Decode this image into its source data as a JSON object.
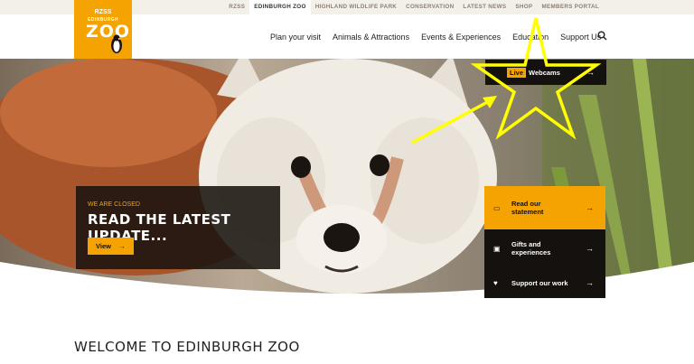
{
  "topnav": [
    "RZSS",
    "EDINBURGH ZOO",
    "HIGHLAND WILDLIFE PARK",
    "CONSERVATION",
    "LATEST NEWS",
    "SHOP",
    "MEMBERS PORTAL"
  ],
  "logo": {
    "rzss": "RZSS",
    "sub": "EDINBURGH",
    "zoo": "ZOO"
  },
  "mainnav": [
    "Plan your visit",
    "Animals & Attractions",
    "Events & Experiences",
    "Education",
    "Support Us"
  ],
  "live": {
    "badge": "Live",
    "label": "Webcams"
  },
  "closed": {
    "kicker": "WE ARE CLOSED",
    "heading": "READ THE LATEST UPDATE...",
    "button": "View"
  },
  "cards": [
    {
      "label": "Read our statement"
    },
    {
      "label": "Gifts and experiences"
    },
    {
      "label": "Support our work"
    }
  ],
  "welcome": "WELCOME TO EDINBURGH ZOO",
  "colors": {
    "accent": "#f4a300",
    "dark": "#15110e",
    "annotation": "#ffff00"
  }
}
